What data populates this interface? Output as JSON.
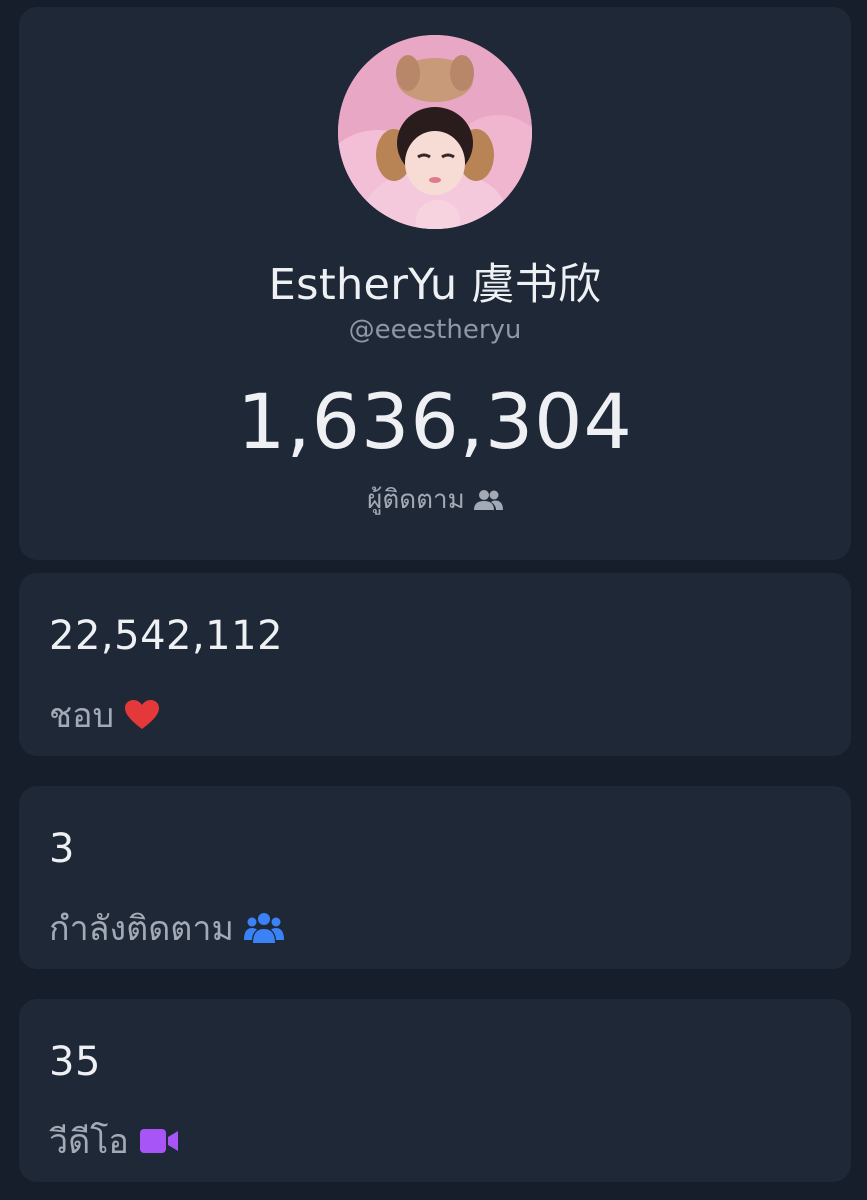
{
  "profile": {
    "display_name": "EstherYu 虞书欣",
    "handle": "@eeestheryu",
    "followers_count": "1,636,304",
    "followers_label": "ผู้ติดตาม",
    "followers_icon": "users-icon"
  },
  "stats": {
    "likes": {
      "value": "22,542,112",
      "label": "ชอบ",
      "icon": "heart-icon",
      "icon_color": "#e5383b"
    },
    "following": {
      "value": "3",
      "label": "กำลังติดตาม",
      "icon": "user-group-icon",
      "icon_color": "#3b82f6"
    },
    "videos": {
      "value": "35",
      "label": "วีดีโอ",
      "icon": "video-camera-icon",
      "icon_color": "#a855f7"
    }
  },
  "colors": {
    "background": "#161d2b",
    "card": "#1f2837",
    "primary_text": "#eef0f3",
    "secondary_text": "#a3aab6"
  }
}
